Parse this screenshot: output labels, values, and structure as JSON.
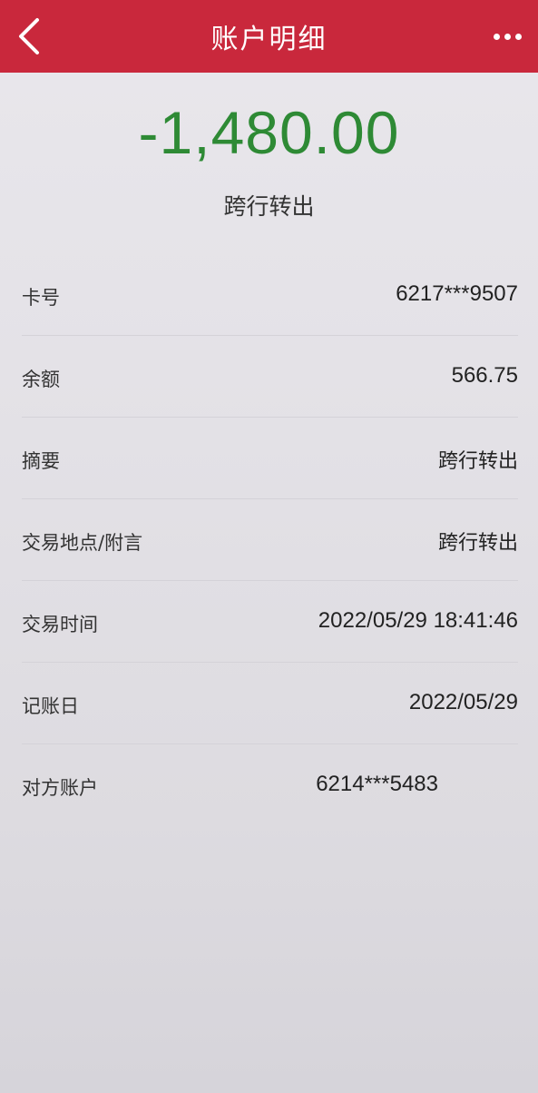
{
  "header": {
    "title": "账户明细",
    "back_icon": "chevron-left-icon",
    "more_icon": "more-horizontal-icon",
    "bar_color": "#c9283c"
  },
  "summary": {
    "amount": "-1,480.00",
    "amount_color": "#2e8a35",
    "description": "跨行转出"
  },
  "details": [
    {
      "label": "卡号",
      "value": "6217***9507"
    },
    {
      "label": "余额",
      "value": "566.75"
    },
    {
      "label": "摘要",
      "value": "跨行转出"
    },
    {
      "label": "交易地点/附言",
      "value": "跨行转出"
    },
    {
      "label": "交易时间",
      "value": "2022/05/29 18:41:46"
    },
    {
      "label": "记账日",
      "value": "2022/05/29"
    },
    {
      "label": "对方账户",
      "value": "6214***5483"
    }
  ]
}
